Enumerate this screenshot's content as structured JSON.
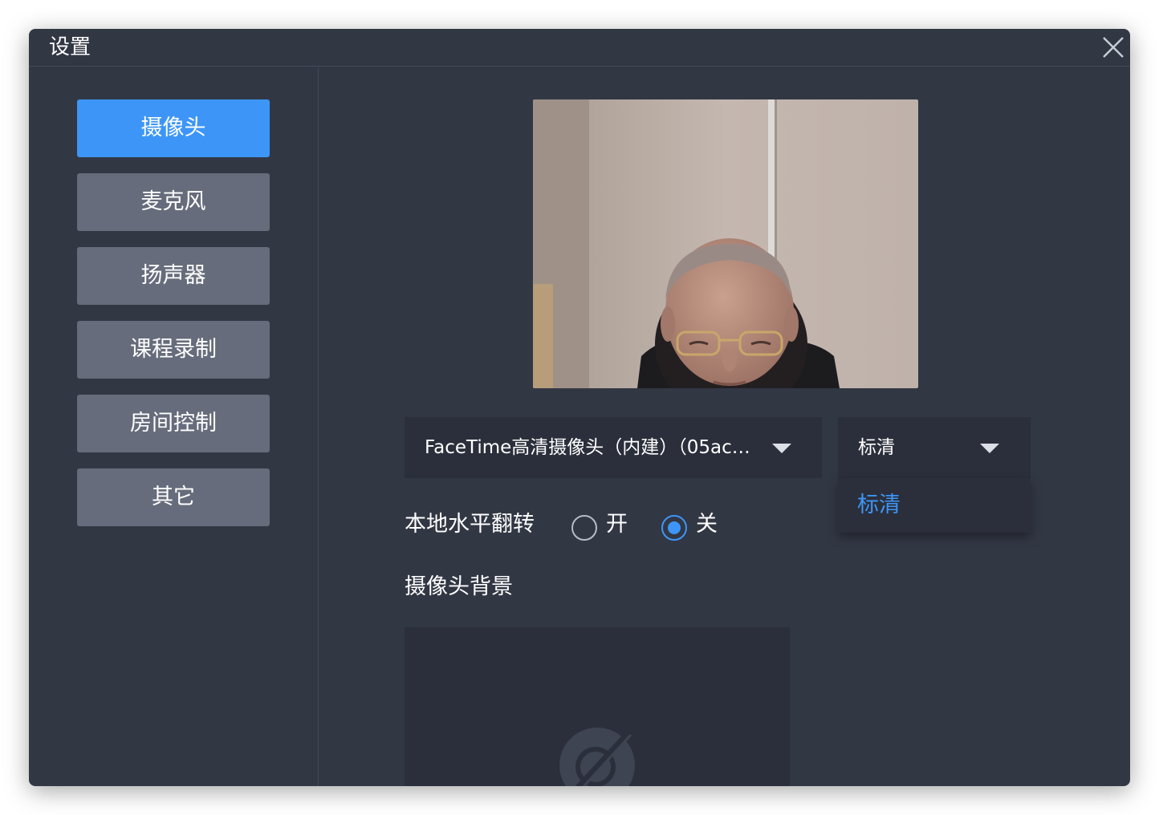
{
  "window": {
    "title": "设置"
  },
  "sidebar": {
    "items": [
      {
        "label": "摄像头",
        "active": true
      },
      {
        "label": "麦克风",
        "active": false
      },
      {
        "label": "扬声器",
        "active": false
      },
      {
        "label": "课程录制",
        "active": false
      },
      {
        "label": "房间控制",
        "active": false
      },
      {
        "label": "其它",
        "active": false
      }
    ]
  },
  "camera": {
    "device_select_value": "FaceTime高清摄像头（内建）（05ac…",
    "quality_select_value": "标清",
    "quality_options": [
      "标清"
    ],
    "mirror_label": "本地水平翻转",
    "mirror_on_label": "开",
    "mirror_off_label": "关",
    "mirror_selected": "关",
    "background_label": "摄像头背景"
  },
  "colors": {
    "window_bg": "#323744",
    "accent": "#3d96f7",
    "nav_inactive": "#666c7b",
    "select_bg": "#2b2f3b"
  },
  "icons": {
    "close": "close-icon",
    "caret": "chevron-down-icon",
    "no_background": "no-image-icon"
  }
}
